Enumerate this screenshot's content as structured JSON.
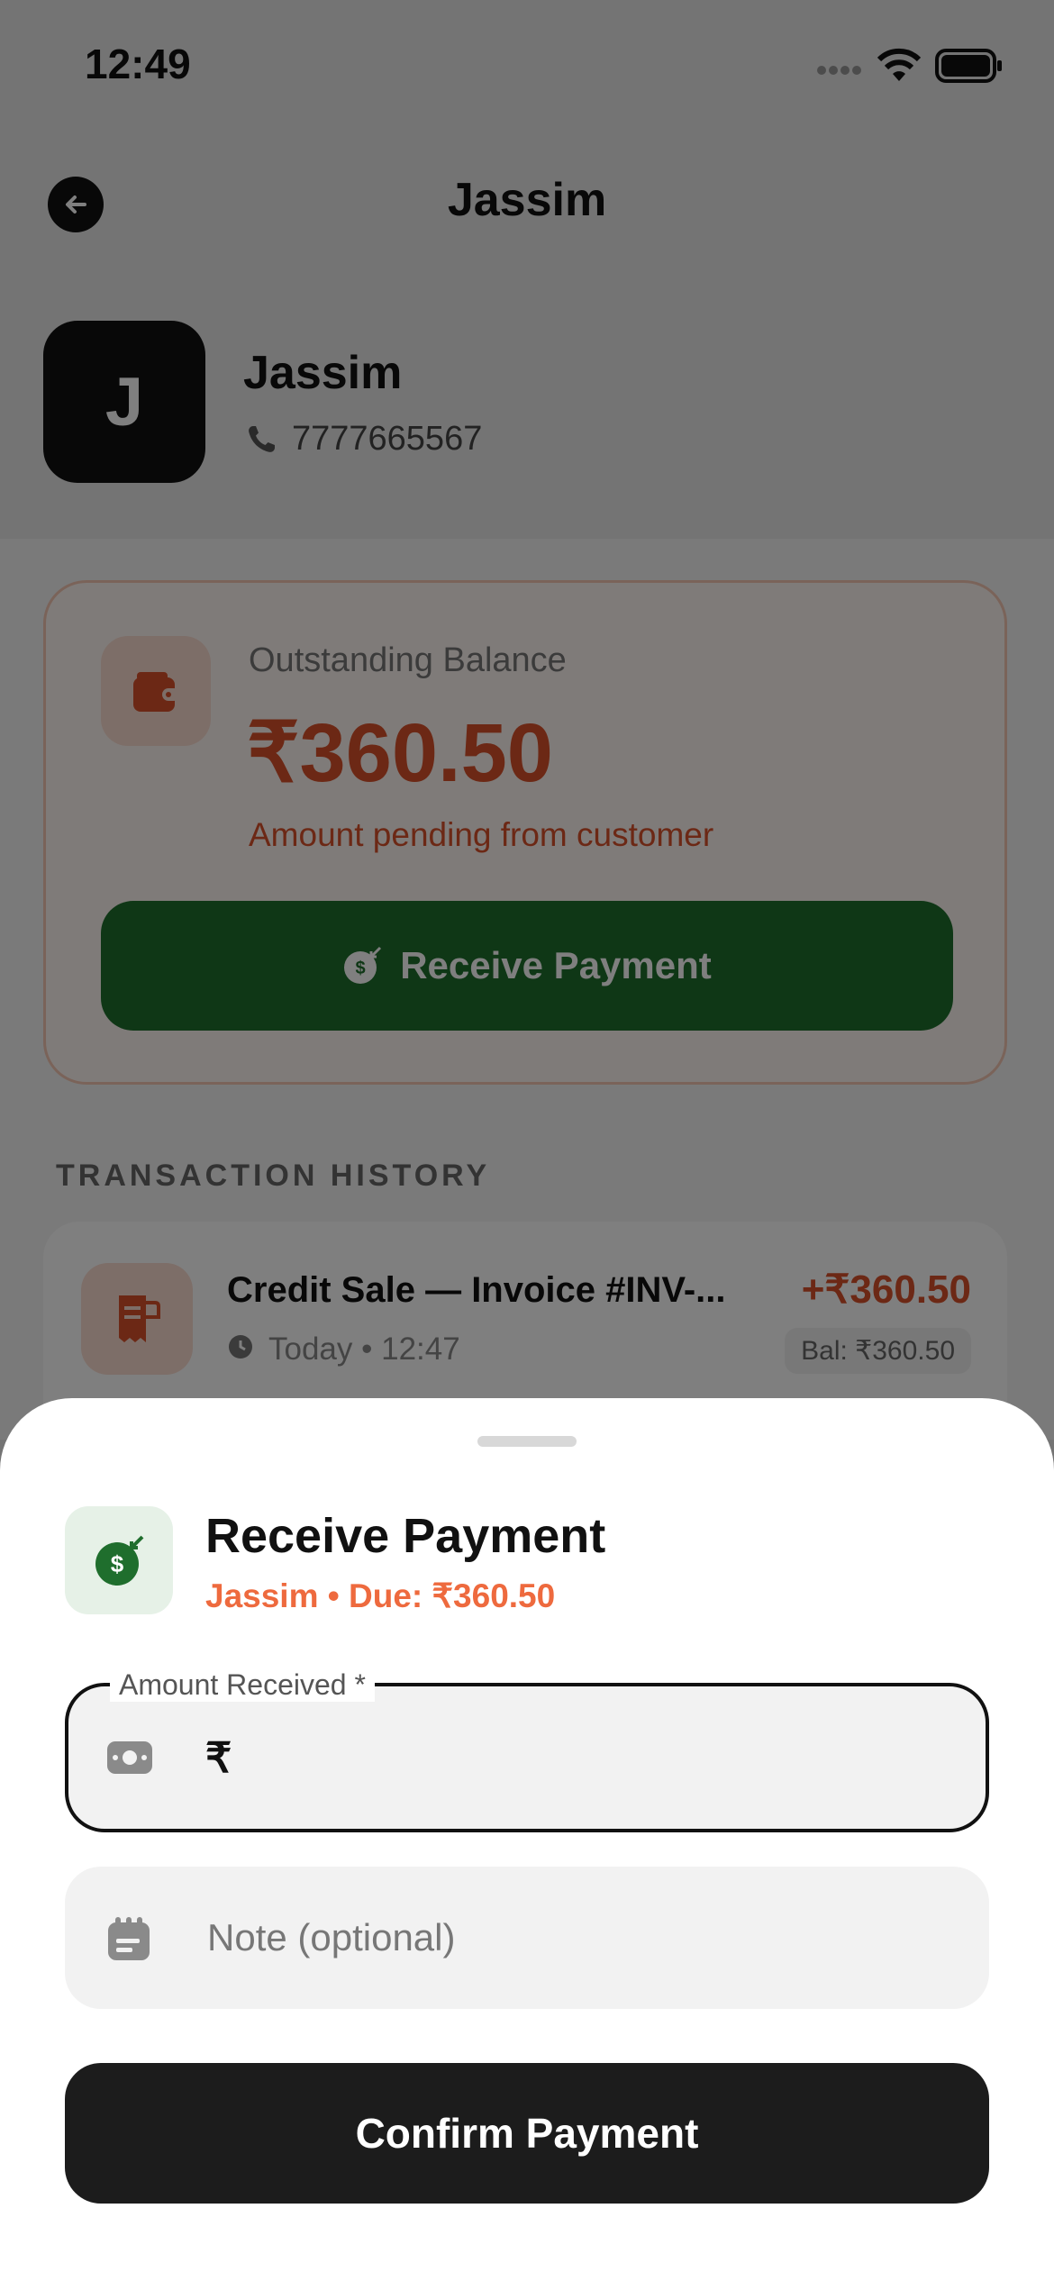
{
  "status_bar": {
    "time": "12:49"
  },
  "header": {
    "title": "Jassim",
    "back_icon": "arrow-left-icon"
  },
  "customer": {
    "initial": "J",
    "name": "Jassim",
    "phone": "7777665567"
  },
  "balance": {
    "label": "Outstanding Balance",
    "amount": "₹360.50",
    "subtext": "Amount pending from customer",
    "button_label": "Receive Payment"
  },
  "history": {
    "heading": "TRANSACTION HISTORY",
    "items": [
      {
        "title": "Credit Sale — Invoice #INV-...",
        "meta": "Today • 12:47",
        "amount": "+₹360.50",
        "balance": "Bal: ₹360.50"
      }
    ]
  },
  "sheet": {
    "title": "Receive Payment",
    "subtitle": "Jassim • Due: ₹360.50",
    "amount_label": "Amount Received *",
    "currency_prefix": "₹",
    "amount_value": "",
    "note_placeholder": "Note (optional)",
    "confirm_label": "Confirm Payment"
  },
  "colors": {
    "accent_orange": "#d9512a",
    "green": "#1f6e2d",
    "dark": "#1c1c1c"
  }
}
